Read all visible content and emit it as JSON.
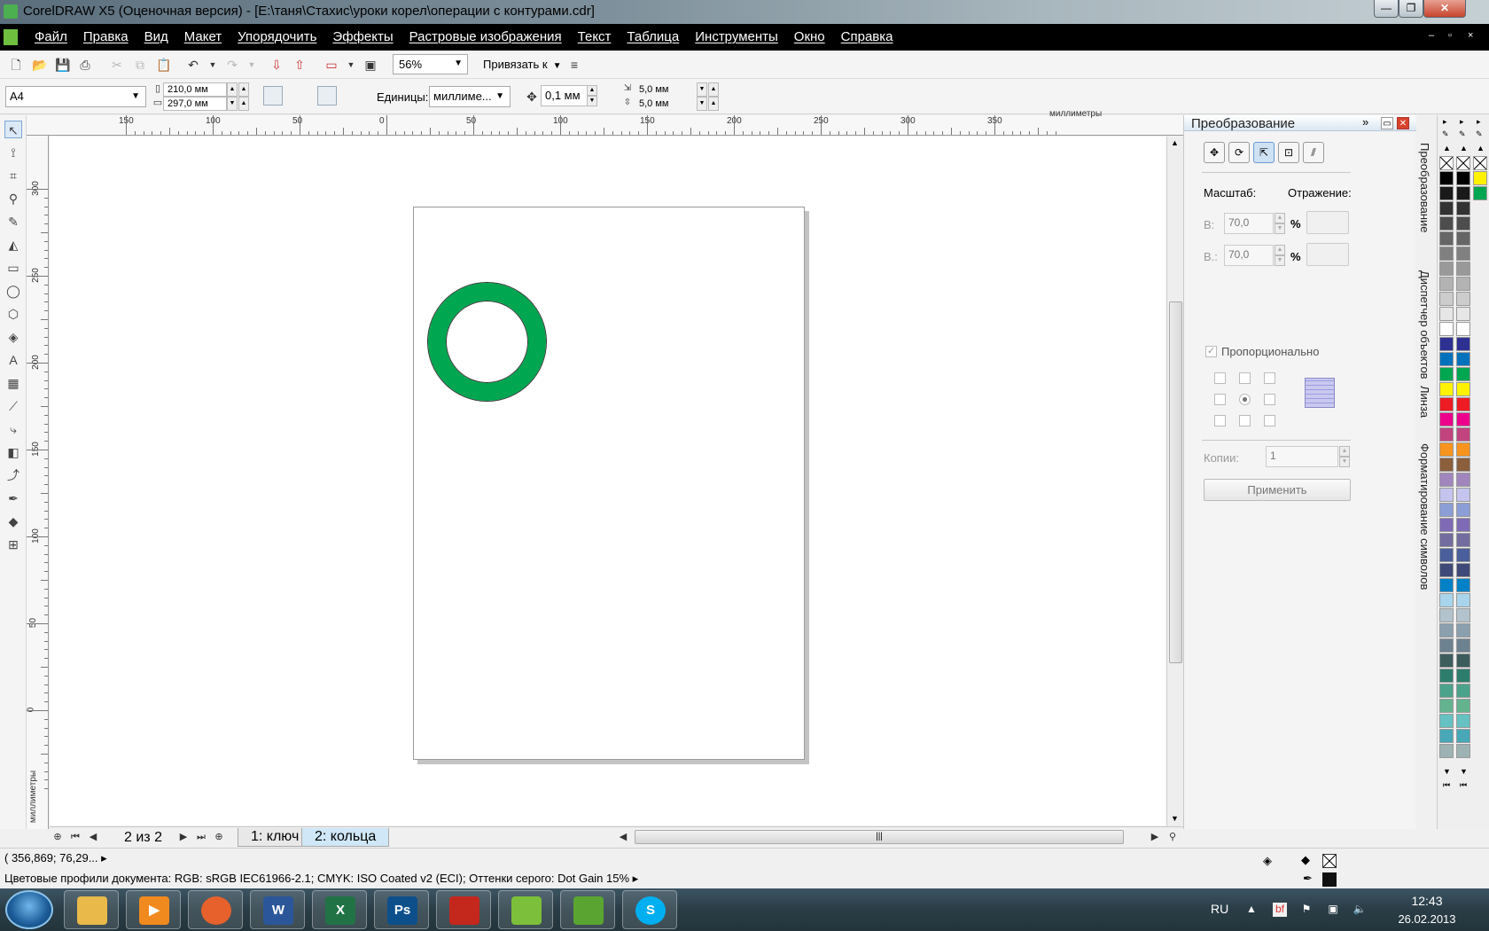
{
  "window": {
    "title": "CorelDRAW X5 (Оценочная версия) - [E:\\таня\\Стахис\\уроки корел\\операции с контурами.cdr]",
    "controls": {
      "minimize": "—",
      "maximize": "❐",
      "close": "✕"
    }
  },
  "menu": {
    "items": [
      "Файл",
      "Правка",
      "Вид",
      "Макет",
      "Упорядочить",
      "Эффекты",
      "Растровые изображения",
      "Текст",
      "Таблица",
      "Инструменты",
      "Окно",
      "Справка"
    ],
    "doc_controls": [
      "‒",
      "▫",
      "×"
    ]
  },
  "standard_toolbar": {
    "zoom_value": "56%",
    "snap_label": "Привязать к"
  },
  "property_bar": {
    "paper_size": "A4",
    "width": "210,0 мм",
    "height": "297,0 мм",
    "units_label": "Единицы:",
    "units_value": "миллиме...",
    "nudge": "0,1 мм",
    "dup_x": "5,0 мм",
    "dup_y": "5,0 мм"
  },
  "rulers": {
    "unit_label": "миллиметры",
    "h_ticks": [
      "150",
      "100",
      "50",
      "0",
      "50",
      "100",
      "150",
      "200",
      "250",
      "300",
      "350"
    ],
    "v_ticks": [
      "300",
      "250",
      "200",
      "150",
      "100",
      "50",
      "0"
    ]
  },
  "pages": {
    "counter": "2 из 2",
    "tabs": [
      "1: ключ",
      "2: кольца"
    ],
    "active_tab": 1
  },
  "docker": {
    "title": "Преобразование",
    "scale_label": "Масштаб:",
    "mirror_label": "Отражение:",
    "h_label": "В:",
    "v_label": "В.:",
    "h_value": "70,0",
    "v_value": "70,0",
    "percent": "%",
    "proportional_label": "Пропорционально",
    "proportional_checked": true,
    "copies_label": "Копии:",
    "copies_value": "1",
    "apply_label": "Применить"
  },
  "side_tabs": [
    "Преобразование",
    "Диспетчер объектов",
    "Линза",
    "Форматирование символов"
  ],
  "palette": {
    "colors_left": [
      "#000000",
      "#1a1a1a",
      "#333333",
      "#4d4d4d",
      "#666666",
      "#808080",
      "#999999",
      "#b3b3b3",
      "#cccccc",
      "#e6e6e6",
      "#ffffff",
      "#2e3192",
      "#0072bc",
      "#00a650",
      "#fff200",
      "#ed1c24",
      "#ec008c",
      "#c1447f",
      "#f7941d",
      "#8b5e3c",
      "#a186be",
      "#c4c4ee",
      "#8c9ed6",
      "#7f6ab5",
      "#736c9e",
      "#4a5f9b",
      "#3f4a78",
      "#0081c6",
      "#a8d5ec",
      "#b3c3cd",
      "#8aa0ae",
      "#6d8290",
      "#3d5d5d",
      "#2d7d6d",
      "#4aa38a",
      "#63b38f",
      "#66c2c2",
      "#48a8b8",
      "#9db3b3"
    ],
    "colors_right": [
      "#000000",
      "#1a1a1a",
      "#333333",
      "#4d4d4d",
      "#666666",
      "#808080",
      "#999999",
      "#b3b3b3",
      "#cccccc",
      "#e6e6e6",
      "#ffffff",
      "#2e3192",
      "#0072bc",
      "#00a650",
      "#fff200",
      "#ed1c24",
      "#ec008c",
      "#c1447f",
      "#f7941d",
      "#8b5e3c",
      "#a186be",
      "#c4c4ee",
      "#8c9ed6",
      "#7f6ab5",
      "#736c9e",
      "#4a5f9b",
      "#3f4a78",
      "#0081c6",
      "#a8d5ec",
      "#b3c3cd",
      "#8aa0ae",
      "#6d8290",
      "#3d5d5d",
      "#2d7d6d",
      "#4aa38a",
      "#63b38f",
      "#66c2c2",
      "#48a8b8",
      "#9db3b3"
    ],
    "colors_custom": [
      "#fff200",
      "#00a650"
    ]
  },
  "status": {
    "coords": "( 356,869; 76,29... ▸",
    "profiles": "Цветовые профили документа: RGB: sRGB IEC61966-2.1; CMYK: ISO Coated v2 (ECI); Оттенки серого: Dot Gain 15% ▸"
  },
  "shape": {
    "fill": "#00a650",
    "outline": "#333333"
  },
  "taskbar": {
    "apps": [
      "Explorer",
      "Media Player",
      "Firefox",
      "Word",
      "Excel",
      "Photoshop",
      "Acrobat",
      "CorelDRAW",
      "Corel CAPTURE",
      "Skype"
    ],
    "app_glyphs": [
      "",
      "▶",
      "",
      "W",
      "X",
      "Ps",
      "",
      "",
      "",
      "S"
    ],
    "lang": "RU",
    "time": "12:43",
    "date": "26.02.2013"
  }
}
